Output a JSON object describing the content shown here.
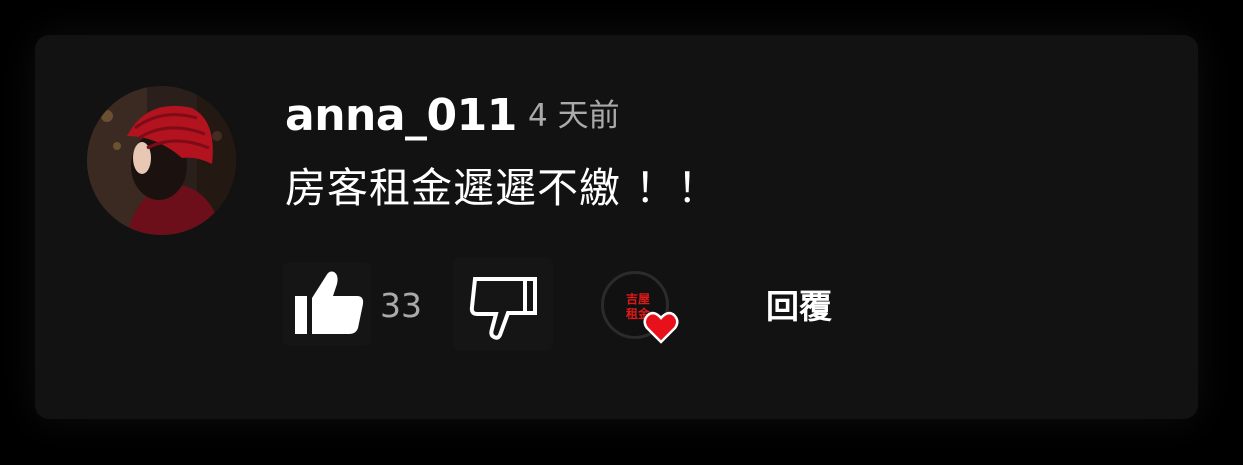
{
  "comment": {
    "username": "anna_011",
    "time_ago": "4 天前",
    "text": "房客租金遲遲不繳 ！！"
  },
  "actions": {
    "like_count": "33",
    "creator_badge_line1": "吉屋",
    "creator_badge_line2": "租金",
    "reply_label": "回覆"
  },
  "icons": {
    "like": "thumbs-up-icon",
    "dislike": "thumbs-down-icon",
    "heart": "heart-icon"
  },
  "colors": {
    "background": "#000000",
    "card": "#121212",
    "text_primary": "#ffffff",
    "text_secondary": "#aaaaaa",
    "heart": "#e8101a",
    "creator_text": "#e01818"
  }
}
